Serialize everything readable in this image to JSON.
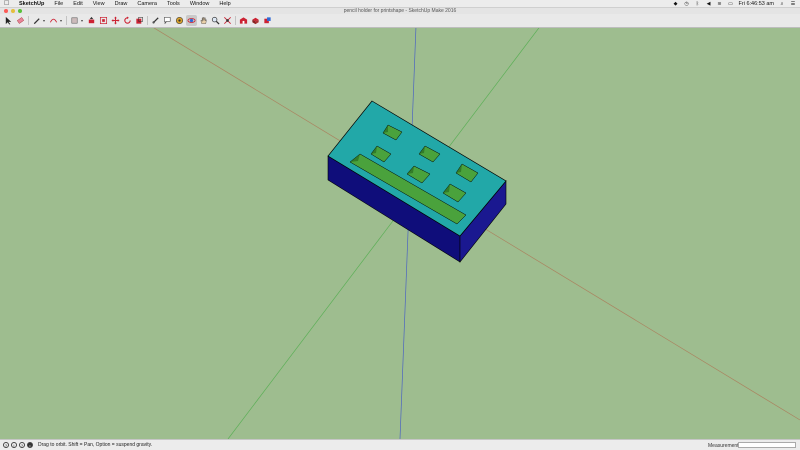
{
  "menubar": {
    "apple": "",
    "items": [
      "SketchUp",
      "File",
      "Edit",
      "View",
      "Draw",
      "Camera",
      "Tools",
      "Window",
      "Help"
    ],
    "clock": "Fri 6:46:53 am"
  },
  "window": {
    "title": "pencil holder for printshape - SketchUp Make 2016"
  },
  "toolbar": {
    "tools": [
      {
        "name": "select-tool",
        "icon": "arrow-cursor-icon"
      },
      {
        "name": "eraser-tool",
        "icon": "eraser-icon"
      },
      {
        "name": "line-tool",
        "icon": "pencil-icon"
      },
      {
        "name": "arc-tool",
        "icon": "arc-icon"
      },
      {
        "name": "rectangle-tool",
        "icon": "rectangle-icon"
      },
      {
        "name": "push-pull-tool",
        "icon": "push-pull-icon"
      },
      {
        "name": "offset-tool",
        "icon": "offset-icon"
      },
      {
        "name": "move-tool",
        "icon": "move-icon"
      },
      {
        "name": "rotate-tool",
        "icon": "rotate-icon"
      },
      {
        "name": "scale-tool",
        "icon": "scale-icon"
      },
      {
        "name": "tape-measure-tool",
        "icon": "tape-measure-icon"
      },
      {
        "name": "text-tool",
        "icon": "text-icon"
      },
      {
        "name": "paint-bucket-tool",
        "icon": "paint-bucket-icon"
      },
      {
        "name": "orbit-tool",
        "icon": "orbit-icon"
      },
      {
        "name": "pan-tool",
        "icon": "hand-icon"
      },
      {
        "name": "zoom-tool",
        "icon": "zoom-icon"
      },
      {
        "name": "zoom-extents-tool",
        "icon": "zoom-extents-icon"
      },
      {
        "name": "warehouse-tool",
        "icon": "warehouse-icon"
      },
      {
        "name": "extension-warehouse-tool",
        "icon": "extension-icon"
      },
      {
        "name": "components-tool",
        "icon": "components-icon"
      }
    ],
    "active_tool": "orbit-tool"
  },
  "statusbar": {
    "hint": "Drag to orbit. Shift = Pan, Option = suspend gravity.",
    "measurements_label": "Measurements",
    "measurements_value": ""
  },
  "colors": {
    "background": "#9ebd8f",
    "top_face": "#22a8a8",
    "side_face": "#0f0d7a",
    "front_face": "#1a1890",
    "hole_face": "#4aa23c",
    "axis_red": "#b4553a",
    "axis_green": "#3aa83a",
    "axis_blue": "#2a3fd6"
  }
}
